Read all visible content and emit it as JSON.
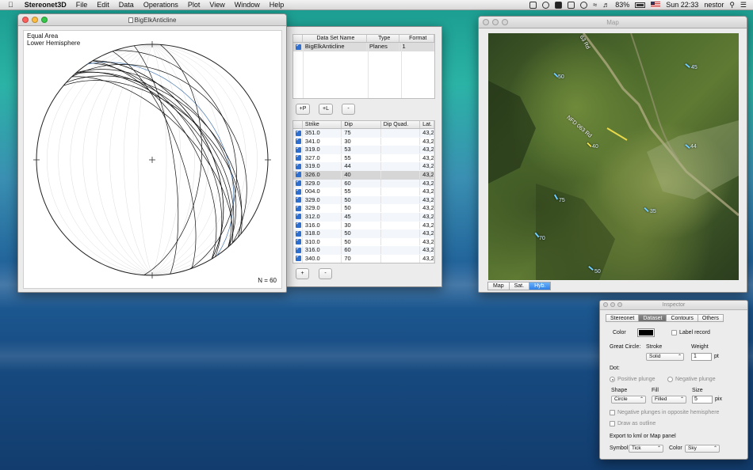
{
  "menubar": {
    "apple_icon": "apple-logo-icon",
    "app_name": "Stereonet3D",
    "menus": [
      "File",
      "Edit",
      "Data",
      "Operations",
      "Plot",
      "View",
      "Window",
      "Help"
    ],
    "battery": "83%",
    "clock": "Sun 22:33",
    "user": "nestor"
  },
  "stereonet_window": {
    "title": "BigElkAnticline",
    "projection": "Equal Area",
    "hemisphere": "Lower Hemisphere",
    "count": "N = 60"
  },
  "dataset_window": {
    "datasets_headers": [
      "",
      "Data Set Name",
      "Type",
      "Format"
    ],
    "datasets": [
      {
        "checked": true,
        "name": "BigElkAnticline",
        "type": "Planes",
        "format": "1"
      }
    ],
    "buttons": {
      "add_planes": "+P",
      "add_lines": "+L",
      "remove_set": "-",
      "add_row": "+",
      "remove_row": "-"
    },
    "records_headers": [
      "",
      "Strike",
      "Dip",
      "Dip Quad.",
      "Lat."
    ],
    "records": [
      {
        "strike": "351.0",
        "dip": "75",
        "quad": "",
        "lat": "43,2"
      },
      {
        "strike": "341.0",
        "dip": "30",
        "quad": "",
        "lat": "43,2"
      },
      {
        "strike": "319.0",
        "dip": "53",
        "quad": "",
        "lat": "43,2"
      },
      {
        "strike": "327.0",
        "dip": "55",
        "quad": "",
        "lat": "43,2"
      },
      {
        "strike": "319.0",
        "dip": "44",
        "quad": "",
        "lat": "43,2"
      },
      {
        "strike": "326.0",
        "dip": "40",
        "quad": "",
        "lat": "43,2"
      },
      {
        "strike": "329.0",
        "dip": "60",
        "quad": "",
        "lat": "43,2"
      },
      {
        "strike": "004.0",
        "dip": "55",
        "quad": "",
        "lat": "43,2"
      },
      {
        "strike": "329.0",
        "dip": "50",
        "quad": "",
        "lat": "43,2"
      },
      {
        "strike": "329.0",
        "dip": "50",
        "quad": "",
        "lat": "43,2"
      },
      {
        "strike": "312.0",
        "dip": "45",
        "quad": "",
        "lat": "43,2"
      },
      {
        "strike": "316.0",
        "dip": "30",
        "quad": "",
        "lat": "43,2"
      },
      {
        "strike": "318.0",
        "dip": "50",
        "quad": "",
        "lat": "43,2"
      },
      {
        "strike": "310.0",
        "dip": "50",
        "quad": "",
        "lat": "43,2"
      },
      {
        "strike": "316.0",
        "dip": "60",
        "quad": "",
        "lat": "43,2"
      },
      {
        "strike": "340.0",
        "dip": "70",
        "quad": "",
        "lat": "43,2"
      }
    ],
    "selected_record": 5
  },
  "map_window": {
    "title": "Map",
    "road_labels": [
      "NFD 063 Rd",
      "63 Rd"
    ],
    "dip_labels": [
      "50",
      "45",
      "40",
      "44",
      "75",
      "35",
      "70",
      "50"
    ],
    "map_types": [
      "Map",
      "Sat.",
      "Hyb."
    ],
    "active_map_type": "Hyb."
  },
  "inspector": {
    "title": "Inspector",
    "tabs": [
      "Stereonet",
      "Dataset",
      "Contours",
      "Others"
    ],
    "active_tab": "Dataset",
    "color_label": "Color",
    "color_value": "#000000",
    "label_record": "Label record",
    "great_circle_label": "Great Circle:",
    "stroke_label": "Stroke",
    "stroke_value": "Solid",
    "weight_label": "Weight",
    "weight_value": "1",
    "weight_unit": "pt",
    "dot_label": "Dot:",
    "positive_plunge": "Positive plunge",
    "negative_plunge": "Negative plunge",
    "shape_label": "Shape",
    "shape_value": "Circle",
    "fill_label": "Fill",
    "fill_value": "Filled",
    "size_label": "Size",
    "size_value": "5",
    "size_unit": "pix",
    "neg_plunges_opposite": "Negative plunges in opposite hemisphere",
    "draw_as_outline": "Draw as outline",
    "export_label": "Export to kml or Map panel",
    "symbol_label": "Symbol",
    "symbol_value": "Tick",
    "export_color_label": "Color",
    "export_color_value": "Sky"
  }
}
